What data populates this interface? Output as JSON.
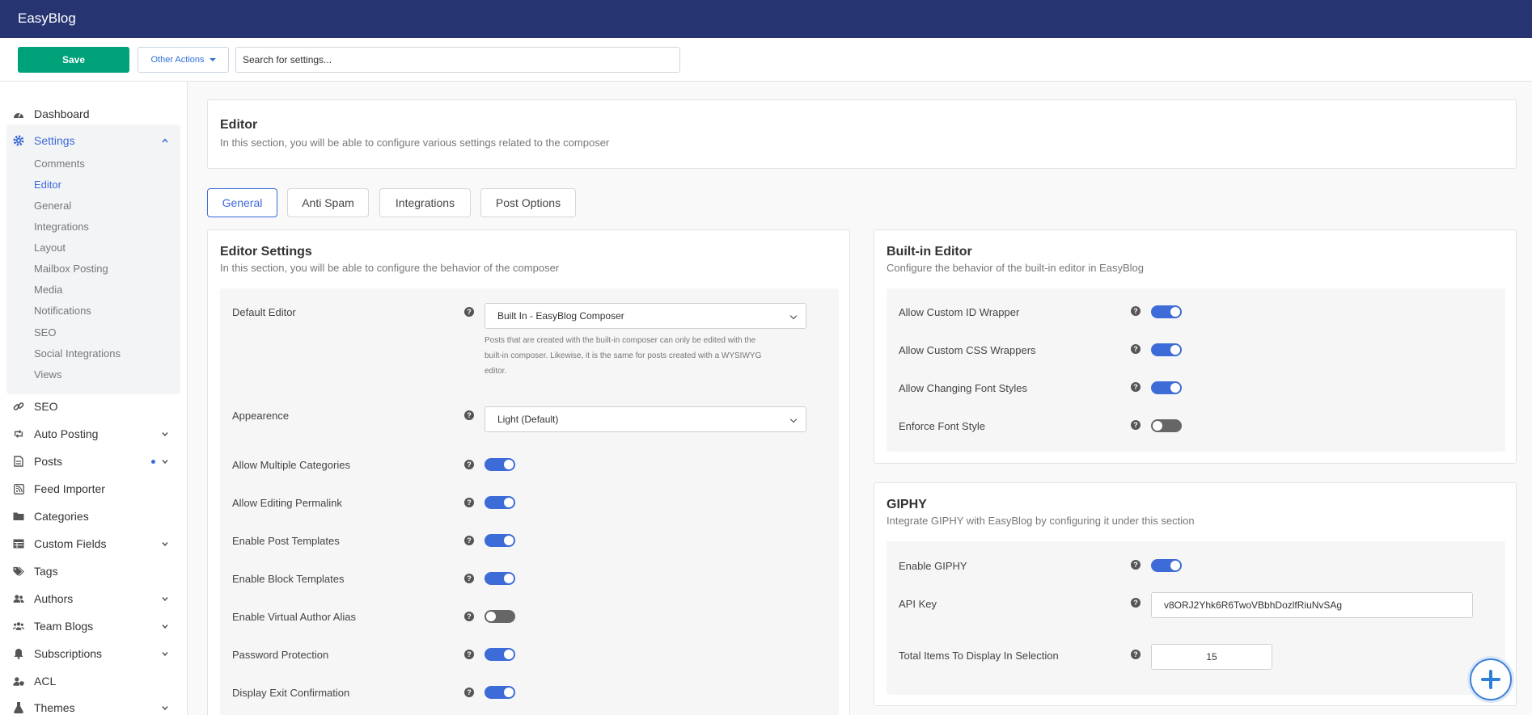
{
  "app": {
    "title": "EasyBlog"
  },
  "toolbar": {
    "save_label": "Save",
    "other_actions_label": "Other Actions",
    "search_placeholder": "Search for settings..."
  },
  "sidebar": {
    "items": [
      {
        "label": "Dashboard",
        "icon": "dashboard-icon"
      },
      {
        "label": "Settings",
        "icon": "gear-icon"
      },
      {
        "label": "SEO",
        "icon": "link-icon"
      },
      {
        "label": "Auto Posting",
        "icon": "retweet-icon"
      },
      {
        "label": "Posts",
        "icon": "file-icon"
      },
      {
        "label": "Feed Importer",
        "icon": "rss-icon"
      },
      {
        "label": "Categories",
        "icon": "folder-icon"
      },
      {
        "label": "Custom Fields",
        "icon": "table-icon"
      },
      {
        "label": "Tags",
        "icon": "tags-icon"
      },
      {
        "label": "Authors",
        "icon": "users-icon"
      },
      {
        "label": "Team Blogs",
        "icon": "team-icon"
      },
      {
        "label": "Subscriptions",
        "icon": "bell-icon"
      },
      {
        "label": "ACL",
        "icon": "user-shield-icon"
      },
      {
        "label": "Themes",
        "icon": "flask-icon"
      }
    ],
    "settings_sub": [
      "Comments",
      "Editor",
      "General",
      "Integrations",
      "Layout",
      "Mailbox Posting",
      "Media",
      "Notifications",
      "SEO",
      "Social Integrations",
      "Views"
    ]
  },
  "header": {
    "title": "Editor",
    "description": "In this section, you will be able to configure various settings related to the composer"
  },
  "tabs": [
    "General",
    "Anti Spam",
    "Integrations",
    "Post Options"
  ],
  "editor_settings": {
    "title": "Editor Settings",
    "description": "In this section, you will be able to configure the behavior of the composer",
    "default_editor": {
      "label": "Default Editor",
      "value": "Built In - EasyBlog Composer",
      "hint_lines": [
        "Posts that are created with the built-in composer can only be edited with the",
        "built-in composer. Likewise, it is the same for posts created with a WYSIWYG",
        "editor."
      ]
    },
    "appearance": {
      "label": "Appearence",
      "value": "Light (Default)"
    },
    "toggles": [
      {
        "label": "Allow Multiple Categories",
        "on": true
      },
      {
        "label": "Allow Editing Permalink",
        "on": true
      },
      {
        "label": "Enable Post Templates",
        "on": true
      },
      {
        "label": "Enable Block Templates",
        "on": true
      },
      {
        "label": "Enable Virtual Author Alias",
        "on": false
      },
      {
        "label": "Password Protection",
        "on": true
      },
      {
        "label": "Display Exit Confirmation",
        "on": true
      }
    ]
  },
  "builtin_editor": {
    "title": "Built-in Editor",
    "description": "Configure the behavior of the built-in editor in EasyBlog",
    "toggles": [
      {
        "label": "Allow Custom ID Wrapper",
        "on": true
      },
      {
        "label": "Allow Custom CSS Wrappers",
        "on": true
      },
      {
        "label": "Allow Changing Font Styles",
        "on": true
      },
      {
        "label": "Enforce Font Style",
        "on": false
      }
    ]
  },
  "giphy": {
    "title": "GIPHY",
    "description": "Integrate GIPHY with EasyBlog by configuring it under this section",
    "enable_label": "Enable GIPHY",
    "enable_on": true,
    "api_key_label": "API Key",
    "api_key_value": "v8ORJ2Yhk6R6TwoVBbhDozlfRiuNvSAg",
    "total_label": "Total Items To Display In Selection",
    "total_value": "15"
  },
  "colors": {
    "topbar": "#263572",
    "save": "#00a27a",
    "accent": "#3c6ad8",
    "toggle_on": "#3d6cd9",
    "toggle_off": "#666666"
  }
}
